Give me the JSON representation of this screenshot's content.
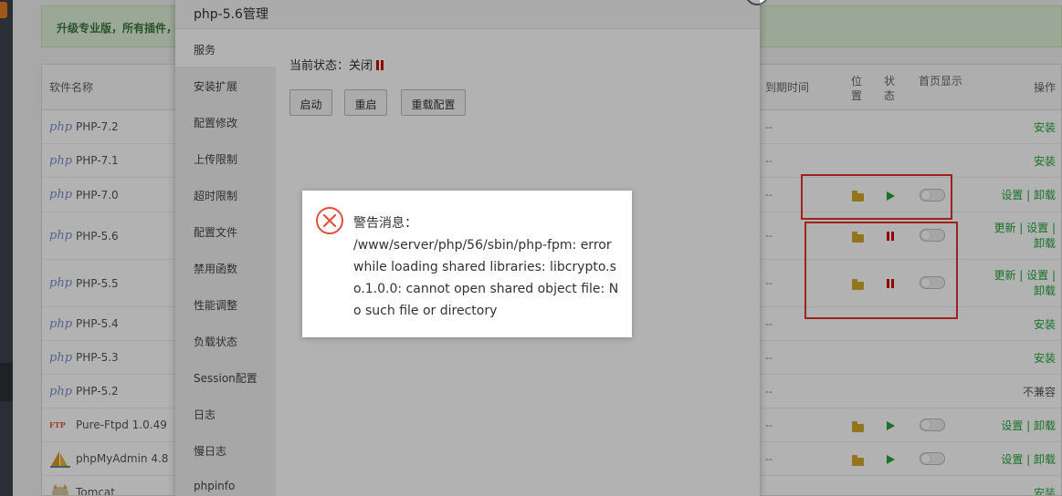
{
  "promo": {
    "text": "升级专业版，所有插件，"
  },
  "table": {
    "headers": {
      "name": "软件名称",
      "expire": "到期时间",
      "location": "位置",
      "status": "状态",
      "homepage": "首页显示",
      "ops": "操作"
    },
    "rows": [
      {
        "logo": "php",
        "name": "PHP-7.2",
        "expire": "--",
        "ops": "安装"
      },
      {
        "logo": "php",
        "name": "PHP-7.1",
        "expire": "--",
        "ops": "安装"
      },
      {
        "logo": "php",
        "name": "PHP-7.0",
        "expire": "--",
        "ops": "设置 | 卸载",
        "status": "running"
      },
      {
        "logo": "php",
        "name": "PHP-5.6",
        "expire": "--",
        "ops": "更新 | 设置 | 卸载",
        "status": "stopped"
      },
      {
        "logo": "php",
        "name": "PHP-5.5",
        "expire": "--",
        "ops": "更新 | 设置 | 卸载",
        "status": "stopped"
      },
      {
        "logo": "php",
        "name": "PHP-5.4",
        "expire": "--",
        "ops": "安装"
      },
      {
        "logo": "php",
        "name": "PHP-5.3",
        "expire": "--",
        "ops": "安装"
      },
      {
        "logo": "php",
        "name": "PHP-5.2",
        "expire": "--",
        "ops": "不兼容"
      },
      {
        "logo": "FTP",
        "name": "Pure-Ftpd 1.0.49",
        "expire": "--",
        "ops": "设置 | 卸载",
        "status": "running"
      },
      {
        "logo": "pma-icon",
        "name": "phpMyAdmin 4.8",
        "expire": "--",
        "ops": "设置 | 卸载",
        "status": "running"
      },
      {
        "logo": "tomcat-icon",
        "name": "Tomcat",
        "expire": "--",
        "ops": "安装"
      }
    ]
  },
  "modal": {
    "title": "php-5.6管理",
    "menu": [
      "服务",
      "安装扩展",
      "配置修改",
      "上传限制",
      "超时限制",
      "配置文件",
      "禁用函数",
      "性能调整",
      "负载状态",
      "Session配置",
      "日志",
      "慢日志",
      "phpinfo"
    ],
    "status_label": "当前状态：关闭",
    "buttons": {
      "start": "启动",
      "restart": "重启",
      "reload": "重载配置"
    }
  },
  "alert": {
    "title": "警告消息：",
    "message": "/www/server/php/56/sbin/php-fpm: error while loading shared libraries: libcrypto.so.1.0.0: cannot open shared object file: No such file or directory",
    "icon": "error-circle-x-icon"
  },
  "colors": {
    "accent": "#20a53a",
    "danger": "#c00000",
    "highlight": "#e3322c"
  }
}
